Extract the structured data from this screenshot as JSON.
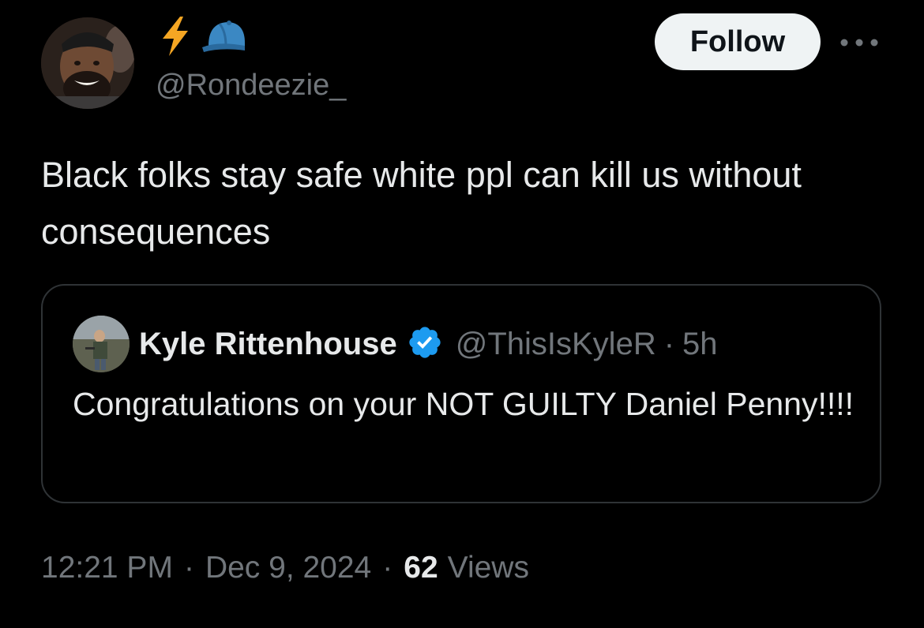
{
  "author": {
    "display_emojis": [
      "lightning-bolt",
      "blue-cap"
    ],
    "handle": "@Rondeezie_",
    "avatar_icon": "user-avatar"
  },
  "actions": {
    "follow_label": "Follow",
    "more_icon": "more-dots-icon"
  },
  "tweet": {
    "text": "Black folks stay safe white ppl can kill us without consequences"
  },
  "quote": {
    "name": "Kyle Rittenhouse",
    "verified": true,
    "handle": "@ThisIsKyleR",
    "separator": "·",
    "time": "5h",
    "text": "Congratulations on your NOT GUILTY Daniel Penny!!!!"
  },
  "meta": {
    "time": "12:21 PM",
    "separator": "·",
    "date": "Dec 9, 2024",
    "views_count": "62",
    "views_label": "Views"
  },
  "colors": {
    "background": "#000000",
    "text_primary": "#e7e9ea",
    "text_secondary": "#71767b",
    "border": "#2f3336",
    "follow_bg": "#eff3f4",
    "verified_blue": "#1d9bf0",
    "lightning": "#f5a623",
    "cap_blue": "#3b88c3"
  }
}
